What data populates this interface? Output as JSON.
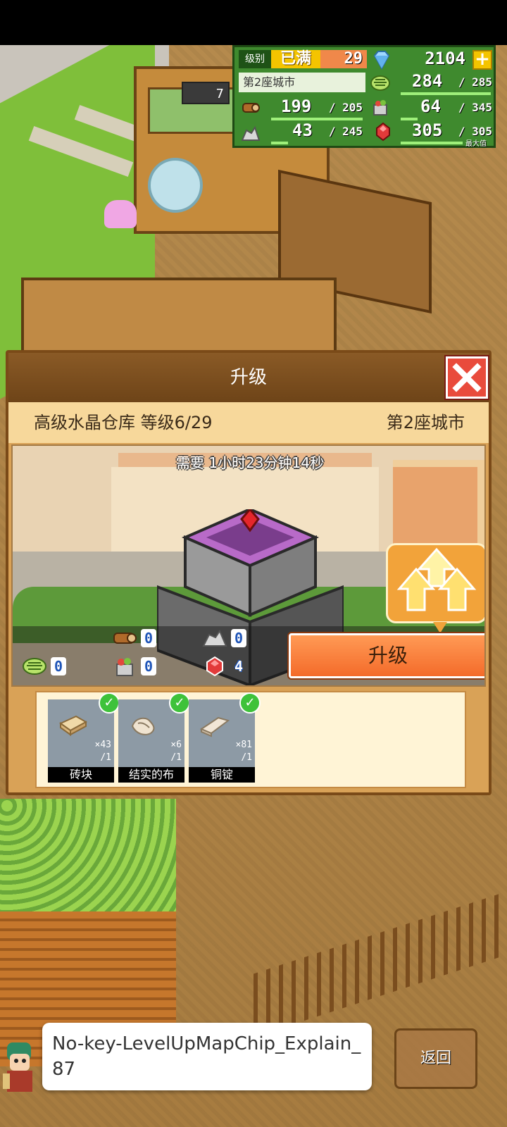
{
  "hud": {
    "level_label": "级别",
    "level_max": "已满",
    "level_value": "29",
    "diamonds": "2104",
    "city_label": "第2座城市",
    "grass_value": "284",
    "grass_max": "285",
    "wood_value": "199",
    "wood_max": "205",
    "food_value": "64",
    "food_max": "345",
    "ore_value": "43",
    "ore_max": "245",
    "crystal_value": "305",
    "crystal_max": "305",
    "crystal_note": "最大值",
    "plus_icon": "plus-icon",
    "map_sign_value": "7"
  },
  "dialog": {
    "title": "升级",
    "close_icon": "close-icon",
    "building_name": "高级水晶仓库 等级6/29",
    "city_name": "第2座城市",
    "time_required": "需要 1小时23分钟14秒",
    "upgrade_label": "升级",
    "costs": [
      {
        "icon": "wood-log-icon",
        "value": "0"
      },
      {
        "icon": "ore-rock-icon",
        "value": "0"
      },
      {
        "icon": "grass-icon",
        "value": "0"
      },
      {
        "icon": "food-basket-icon",
        "value": "0"
      },
      {
        "icon": "red-crystal-icon",
        "value": "4"
      }
    ],
    "materials": [
      {
        "name": "砖块",
        "have": "×43",
        "need": "/1",
        "icon": "brick-icon"
      },
      {
        "name": "结实的布",
        "have": "×6",
        "need": "/1",
        "icon": "cloth-icon"
      },
      {
        "name": "铜锭",
        "have": "×81",
        "need": "/1",
        "icon": "copper-ingot-icon"
      }
    ]
  },
  "tooltip": {
    "text": "No-key-LevelUpMapChip_Explain_87"
  },
  "back_button": {
    "label": "返回"
  }
}
